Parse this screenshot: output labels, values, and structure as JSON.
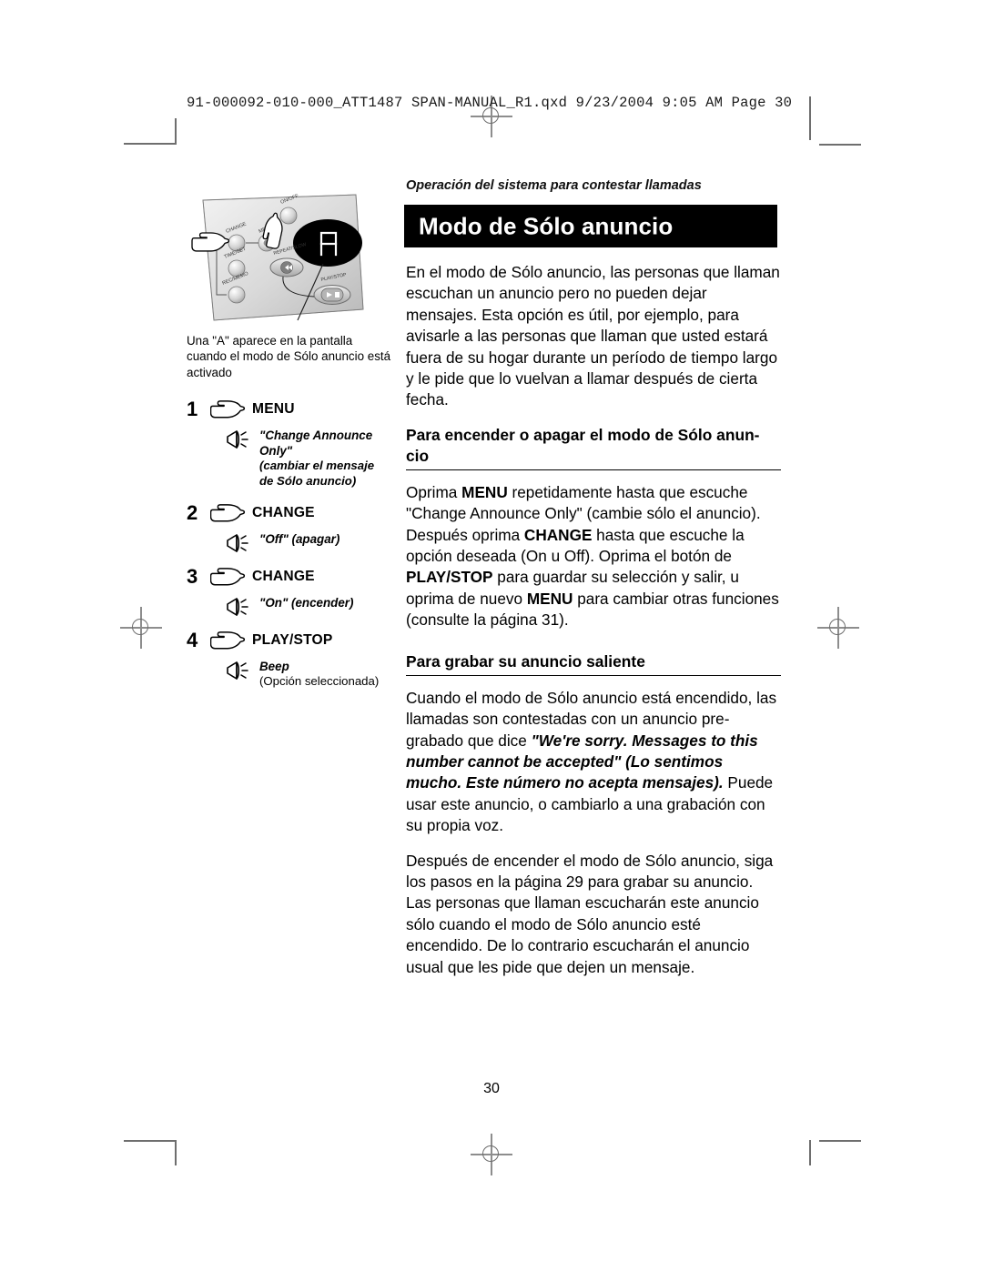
{
  "prepress": {
    "slug": "91-000092-010-000_ATT1487 SPAN-MANUAL_R1.qxd  9/23/2004  9:05 AM  Page 30"
  },
  "running_head": "Operación del sistema para contestar llamadas",
  "title": "Modo de Sólo anuncio",
  "folio": "30",
  "figure": {
    "caption": "Una \"A\" aparece en la pantalla cuando el modo de Sólo anuncio está activado",
    "display_glyph": "A",
    "buttons": [
      "ON/OFF",
      "CHANGE",
      "MENU",
      "TIME/SET",
      "REC/MEMO",
      "REPEAT/SLOW",
      "PLAY/STOP"
    ]
  },
  "steps": [
    {
      "num": "1",
      "button": "MENU",
      "cue_quote": "\"Change Announce Only\"",
      "cue_plain": "(cambiar el mensaje de Sólo anuncio)",
      "cue_plain_italic": true
    },
    {
      "num": "2",
      "button": "CHANGE",
      "cue_quote": "\"Off\" (apagar)",
      "cue_plain": "",
      "cue_plain_italic": false
    },
    {
      "num": "3",
      "button": "CHANGE",
      "cue_quote": "\"On\" (encender)",
      "cue_plain": "",
      "cue_plain_italic": false
    },
    {
      "num": "4",
      "button": "PLAY/STOP",
      "cue_quote": "Beep",
      "cue_plain": "(Opción seleccionada)",
      "cue_plain_italic": false
    }
  ],
  "body": {
    "intro": "En el modo de Sólo anuncio, las personas que llaman escuchan un anuncio pero no pueden dejar mensajes. Esta opción es útil, por ejemplo, para avisarle a las personas que llaman que usted estará fuera de su hogar durante un período de tiempo largo y le pide que lo vuelvan a llamar después de cierta fecha.",
    "section1": {
      "heading": "Para encender o apagar el modo de Sólo anun-cio",
      "p1_a": "Oprima ",
      "p1_b1": "MENU",
      "p1_b": " repetidamente hasta que escuche \"Change Announce Only\" (cambie sólo el anuncio). Después oprima ",
      "p1_b2": "CHANGE",
      "p1_c": " hasta que escuche la opción deseada (On u Off). Oprima el botón de ",
      "p1_b3": "PLAY/STOP",
      "p1_d": " para guardar su selección y salir, u oprima de nuevo ",
      "p1_b4": "MENU",
      "p1_e": " para cambiar otras funciones (consulte la página 31)."
    },
    "section2": {
      "heading": "Para grabar su anuncio saliente",
      "p1_a": "Cuando el modo de Sólo anuncio está encendido, las llamadas son contestadas con un anuncio pre-grabado que dice ",
      "p1_bi": "\"We're sorry. Messages to this number cannot be accepted\" (Lo sentimos mucho. Este número no acepta mensajes).",
      "p1_b": " Puede usar este anuncio, o cambiarlo a una grabación con su propia voz.",
      "p2": "Después de encender el modo de Sólo anuncio, siga los pasos en la página 29 para grabar su anuncio. Las personas que llaman escucharán este anuncio sólo cuando el modo de Sólo anuncio esté encendido. De lo contrario escucharán el anuncio usual que les pide que dejen un mensaje."
    }
  }
}
